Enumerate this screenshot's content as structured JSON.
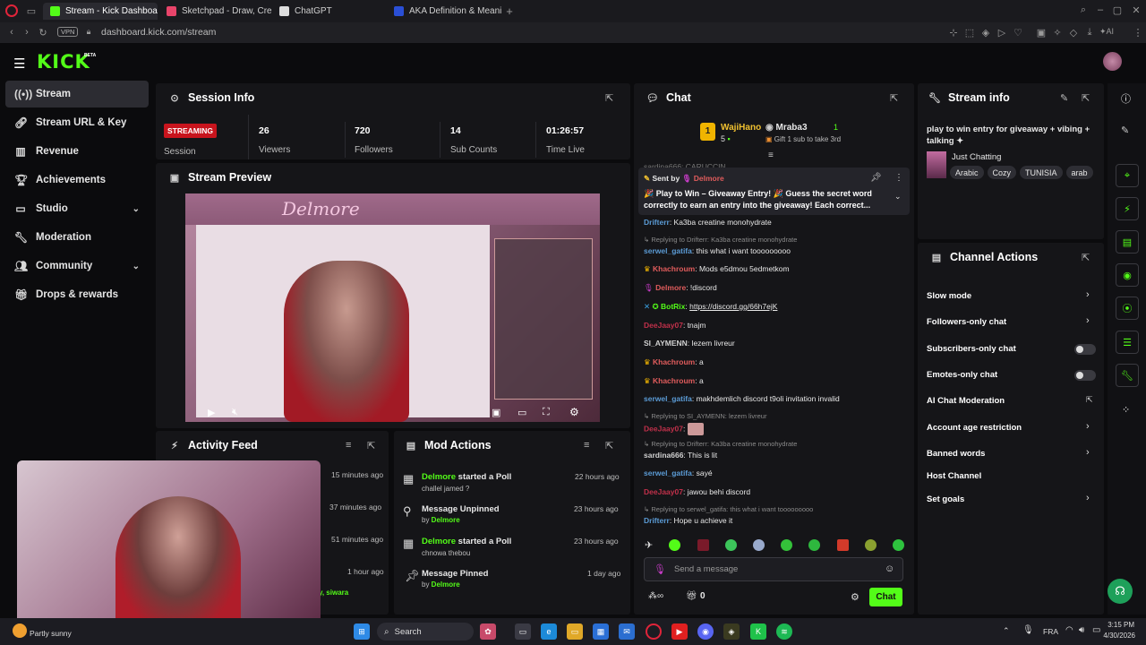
{
  "browser": {
    "tabs": [
      {
        "title": "Stream - Kick Dashboard",
        "active": true
      },
      {
        "title": "Sketchpad - Draw, Create"
      },
      {
        "title": "ChatGPT"
      },
      {
        "title": "AKA Definition & Meaning"
      }
    ],
    "vpn": "VPN",
    "url": "dashboard.kick.com/stream",
    "ai_label": "AI"
  },
  "logo": {
    "text": "KICK",
    "beta": "BETA"
  },
  "sidebar": {
    "items": [
      {
        "label": "Stream",
        "icon": "broadcast-icon",
        "active": true
      },
      {
        "label": "Stream URL & Key",
        "icon": "link-icon"
      },
      {
        "label": "Revenue",
        "icon": "chart-icon"
      },
      {
        "label": "Achievements",
        "icon": "trophy-icon"
      },
      {
        "label": "Studio",
        "icon": "monitor-icon",
        "expandable": true
      },
      {
        "label": "Moderation",
        "icon": "wrench-icon"
      },
      {
        "label": "Community",
        "icon": "people-icon",
        "expandable": true
      },
      {
        "label": "Drops & rewards",
        "icon": "gift-icon"
      }
    ]
  },
  "session": {
    "title": "Session Info",
    "badge": "STREAMING",
    "badge_label": "Session",
    "stats": [
      {
        "value": "26",
        "label": "Viewers"
      },
      {
        "value": "720",
        "label": "Followers"
      },
      {
        "value": "14",
        "label": "Sub Counts"
      },
      {
        "value": "01:26:57",
        "label": "Time Live"
      }
    ]
  },
  "preview": {
    "title": "Stream Preview",
    "overlay_name": "Delmore"
  },
  "activity": {
    "title": "Activity Feed",
    "times": [
      "15 minutes ago",
      "37 minutes ago",
      "51 minutes ago",
      "1 hour ago"
    ],
    "partial_text": "y, siwara"
  },
  "mod_actions": {
    "title": "Mod Actions",
    "items": [
      {
        "user": "Delmore",
        "action": " started a Poll",
        "sub": "challel jamed ?",
        "time": "22 hours ago",
        "icon": "poll-icon"
      },
      {
        "user": "",
        "action": "Message Unpinned",
        "by_prefix": "by ",
        "by": "Delmore",
        "time": "23 hours ago",
        "icon": "unpin-icon"
      },
      {
        "user": "Delmore",
        "action": " started a Poll",
        "sub": "chnowa thebou",
        "time": "23 hours ago",
        "icon": "poll-icon"
      },
      {
        "user": "",
        "action": "Message Pinned",
        "by_prefix": "by ",
        "by": "Delmore",
        "time": "1 day ago",
        "icon": "pin-icon"
      }
    ]
  },
  "chat": {
    "title": "Chat",
    "leaderboard": [
      {
        "rank": "1",
        "name": "WajiHano",
        "count": "5"
      },
      {
        "name": "Mraba3",
        "count": "1",
        "note": "Gift 1 sub to take 3rd"
      }
    ],
    "partial_line": "sardina666: CARUCCIN",
    "pinned": {
      "sent_by_label": "Sent by",
      "sender": "Delmore",
      "text": "🎉 Play to Win – Giveaway Entry! 🎉 Guess the secret word correctly to earn an entry into the giveaway! Each correct..."
    },
    "messages": [
      {
        "user": "Drifterr",
        "color": "#5b9bd5",
        "text": ": Ka3ba creatine monohydrate"
      },
      {
        "reply": "Replying to Drifterr: Ka3ba creatine monohydrate"
      },
      {
        "user": "serwel_gatifa",
        "color": "#5b9bd5",
        "text": ": this what i want tooooooooo"
      },
      {
        "user": "Khachroum",
        "color": "#e05c5c",
        "badge": "crown",
        "text": ": Mods e5dmou 5edmetkom"
      },
      {
        "user": "Delmore",
        "color": "#e05c5c",
        "badge": "mic",
        "text": ": !discord"
      },
      {
        "user": "BotRix",
        "color": "#53fc18",
        "badge": "bot",
        "text": ": ",
        "link": "https://discord.gg/66h7ejK"
      },
      {
        "user": "DeeJaay07",
        "color": "#c0304a",
        "text": ": tnajm"
      },
      {
        "user": "SI_AYMENN",
        "color": "#d0d0d0",
        "text": ": lezem livreur"
      },
      {
        "user": "Khachroum",
        "color": "#e05c5c",
        "badge": "crown",
        "text": ": a"
      },
      {
        "user": "Khachroum",
        "color": "#e05c5c",
        "badge": "crown",
        "text": ": a"
      },
      {
        "user": "serwel_gatifa",
        "color": "#5b9bd5",
        "text": ": makhdemlich discord t9oli invitation invalid"
      },
      {
        "reply": "Replying to SI_AYMENN: lezem livreur"
      },
      {
        "user": "DeeJaay07",
        "color": "#c0304a",
        "text": ": ",
        "emote": true
      },
      {
        "reply": "Replying to Drifterr: Ka3ba creatine monohydrate"
      },
      {
        "user": "sardina666",
        "color": "#d0d0d0",
        "text": ": This is lit"
      },
      {
        "user": "serwel_gatifa",
        "color": "#5b9bd5",
        "text": ": sayé"
      },
      {
        "user": "DeeJaay07",
        "color": "#c0304a",
        "text": ": jawou behi discord"
      },
      {
        "reply": "Replying to serwel_gatifa: this what i want tooooooooo"
      },
      {
        "user": "Drifterr",
        "color": "#5b9bd5",
        "text": ": Hope u achieve it"
      }
    ],
    "input_placeholder": "Send a message",
    "footer_count": "0",
    "send_label": "Chat"
  },
  "stream_info": {
    "title": "Stream info",
    "stream_title": "play to win entry for giveaway + vibing + talking ✦",
    "category": "Just Chatting",
    "tags": [
      "Arabic",
      "Cozy",
      "TUNISIA",
      "arab"
    ]
  },
  "channel_actions": {
    "title": "Channel Actions",
    "items": [
      {
        "label": "Slow mode",
        "control": "chevron"
      },
      {
        "label": "Followers-only chat",
        "control": "chevron"
      },
      {
        "label": "Subscribers-only chat",
        "control": "toggle"
      },
      {
        "label": "Emotes-only chat",
        "control": "toggle"
      },
      {
        "label": "AI Chat Moderation",
        "control": "external"
      },
      {
        "label": "Account age restriction",
        "control": "chevron"
      },
      {
        "label": "Banned words",
        "control": "chevron"
      },
      {
        "label": "Host Channel",
        "control": "none"
      },
      {
        "label": "Set goals",
        "control": "chevron"
      }
    ]
  },
  "taskbar": {
    "weather": "Partly sunny",
    "search": "Search",
    "lang": "FRA",
    "time": "3:15 PM",
    "date": "4/30/2026"
  },
  "colors": {
    "accent": "#53fc18",
    "streaming": "#c8141d",
    "panel": "#151518"
  }
}
